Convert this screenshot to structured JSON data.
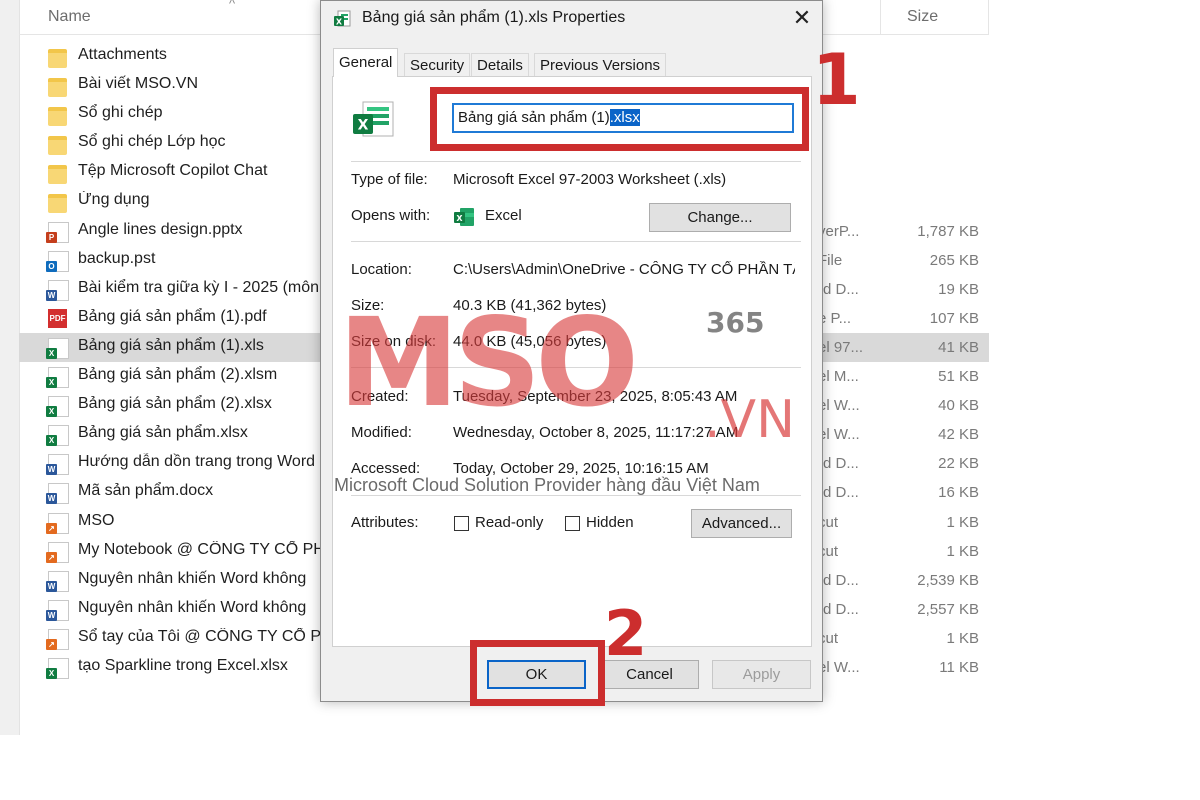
{
  "explorer": {
    "columns": {
      "name": "Name",
      "size": "Size"
    },
    "files": [
      {
        "name": "Attachments",
        "type": "",
        "size": "",
        "icon": "folder"
      },
      {
        "name": "Bài viết MSO.VN",
        "type": "",
        "size": "",
        "icon": "folder"
      },
      {
        "name": "Sổ ghi chép",
        "type": "",
        "size": "",
        "icon": "folder"
      },
      {
        "name": "Sổ ghi chép Lớp học",
        "type": "",
        "size": "",
        "icon": "folder"
      },
      {
        "name": "Tệp Microsoft Copilot Chat",
        "type": "",
        "size": "",
        "icon": "folder"
      },
      {
        "name": "Ứng dụng",
        "type": "",
        "size": "",
        "icon": "folder"
      },
      {
        "name": "Angle lines design.pptx",
        "type": "verP...",
        "size": "1,787 KB",
        "icon": "powerpoint"
      },
      {
        "name": "backup.pst",
        "type": "File",
        "size": "265 KB",
        "icon": "outlook"
      },
      {
        "name": "Bài kiểm tra giữa kỳ I - 2025 (môn",
        "type": "rd D...",
        "size": "19 KB",
        "icon": "word"
      },
      {
        "name": "Bảng giá sản phẩm (1).pdf",
        "type": "e P...",
        "size": "107 KB",
        "icon": "pdf"
      },
      {
        "name": "Bảng giá sản phẩm (1).xls",
        "type": "el 97...",
        "size": "41 KB",
        "icon": "excel",
        "selected": true
      },
      {
        "name": "Bảng giá sản phẩm (2).xlsm",
        "type": "el M...",
        "size": "51 KB",
        "icon": "excel"
      },
      {
        "name": "Bảng giá sản phẩm (2).xlsx",
        "type": "el W...",
        "size": "40 KB",
        "icon": "excel"
      },
      {
        "name": "Bảng giá sản phẩm.xlsx",
        "type": "el W...",
        "size": "42 KB",
        "icon": "excel"
      },
      {
        "name": "Hướng dẫn dồn trang trong Word",
        "type": "rd D...",
        "size": "22 KB",
        "icon": "word"
      },
      {
        "name": "Mã sản phẩm.docx",
        "type": "rd D...",
        "size": "16 KB",
        "icon": "word"
      },
      {
        "name": "MSO",
        "type": "cut",
        "size": "1 KB",
        "icon": "shortcut"
      },
      {
        "name": "My Notebook @ CÔNG TY CỔ PH",
        "type": "cut",
        "size": "1 KB",
        "icon": "shortcut"
      },
      {
        "name": "Nguyên nhân khiến Word không",
        "type": "rd D...",
        "size": "2,539 KB",
        "icon": "word"
      },
      {
        "name": "Nguyên nhân khiến Word không",
        "type": "rd D...",
        "size": "2,557 KB",
        "icon": "word"
      },
      {
        "name": "Sổ tay của Tôi @ CÔNG TY CỔ PH",
        "type": "cut",
        "size": "1 KB",
        "icon": "shortcut"
      },
      {
        "name": "tạo Sparkline trong Excel.xlsx",
        "type": "el W...",
        "size": "11 KB",
        "icon": "excel"
      }
    ]
  },
  "dialog": {
    "title": "Bảng giá sản phẩm (1).xls Properties",
    "tabs": [
      "General",
      "Security",
      "Details",
      "Previous Versions"
    ],
    "active_tab": "General",
    "filename_base": "Bảng giá sản phẩm (1)",
    "filename_ext": ".xlsx",
    "type_label": "Type of file:",
    "type_value": "Microsoft Excel 97-2003 Worksheet (.xls)",
    "opens_label": "Opens with:",
    "opens_value": "Excel",
    "change_button": "Change...",
    "location_label": "Location:",
    "location_value": "C:\\Users\\Admin\\OneDrive - CÔNG TY CỔ PHẦN TẬ",
    "size_label": "Size:",
    "size_value": "40.3 KB (41,362 bytes)",
    "size_disk_label": "Size on disk:",
    "size_disk_value": "44.0 KB (45,056 bytes)",
    "created_label": "Created:",
    "created_value": "Tuesday, September 23, 2025, 8:05:43 AM",
    "modified_label": "Modified:",
    "modified_value": "Wednesday, October 8, 2025, 11:17:27 AM",
    "accessed_label": "Accessed:",
    "accessed_value": "Today, October 29, 2025, 10:16:15 AM",
    "attributes_label": "Attributes:",
    "readonly_label": "Read-only",
    "readonly_checked": false,
    "hidden_label": "Hidden",
    "hidden_checked": false,
    "advanced_button": "Advanced...",
    "ok_button": "OK",
    "cancel_button": "Cancel",
    "apply_button": "Apply"
  },
  "annotations": {
    "step1": "1",
    "step2": "2",
    "color": "#cc2e2e"
  },
  "watermark": {
    "brand": "MSO",
    "product": "365",
    "domain": ".VN",
    "tagline": "Microsoft Cloud Solution Provider hàng đầu Việt Nam"
  }
}
